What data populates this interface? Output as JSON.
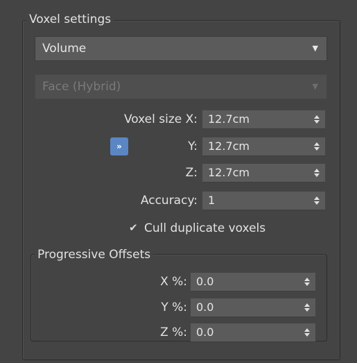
{
  "voxel_settings": {
    "group_title": "Voxel settings",
    "mode_dropdown": {
      "value": "Volume"
    },
    "face_dropdown": {
      "value": "Face (Hybrid)",
      "disabled": true
    },
    "size_x": {
      "label": "Voxel size X:",
      "value": "12.7cm"
    },
    "size_y": {
      "label": "Y:",
      "value": "12.7cm"
    },
    "size_z": {
      "label": "Z:",
      "value": "12.7cm"
    },
    "lock_button": {
      "glyph": "»"
    },
    "accuracy": {
      "label": "Accuracy:",
      "value": "1"
    },
    "cull_duplicates": {
      "label": "Cull duplicate voxels",
      "checked": true,
      "glyph": "✔"
    }
  },
  "progressive_offsets": {
    "group_title": "Progressive Offsets",
    "x": {
      "label": "X %:",
      "value": "0.0"
    },
    "y": {
      "label": "Y %:",
      "value": "0.0"
    },
    "z": {
      "label": "Z %:",
      "value": "0.0"
    }
  },
  "icons": {
    "dropdown_arrow": "▼",
    "spinner_arrows": "up-down-triangles"
  },
  "colors": {
    "background": "#444444",
    "field": "#5b5b5b",
    "lock_button": "#5b86c4",
    "text": "#e2e2e2",
    "disabled_text": "#7a7a7a"
  }
}
